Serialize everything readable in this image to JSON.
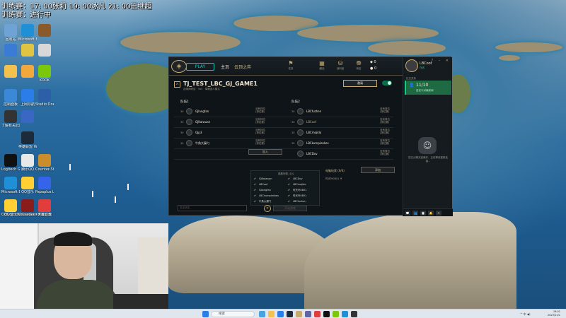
{
  "overlay": {
    "line1": "训练赛：17: 00张莉 19: 00冰凡 21: 00王继超",
    "line2": "训练赛：进行中"
  },
  "desktop_icons": [
    {
      "label": "回收站",
      "icon": "recycle-bin-icon",
      "color": "#6fa3d6"
    },
    {
      "label": "Microsoft Edge",
      "icon": "edge-icon",
      "color": "#1f8fd6"
    },
    {
      "label": "",
      "icon": "app-icon",
      "color": "#8b5a2b"
    },
    {
      "label": "",
      "icon": "app-icon",
      "color": "#3a7bd5"
    },
    {
      "label": "",
      "icon": "app-icon",
      "color": "#e1c542"
    },
    {
      "label": "",
      "icon": "app-icon",
      "color": "#d8d8d8"
    },
    {
      "label": "",
      "icon": "folder-icon",
      "color": "#f2c14e"
    },
    {
      "label": "",
      "icon": "app-icon",
      "color": "#f2a93b"
    },
    {
      "label": "KOOK",
      "icon": "kook-icon",
      "color": "#7ac70c"
    },
    {
      "label": "控制面板",
      "icon": "control-panel-icon",
      "color": "#3b88d8"
    },
    {
      "label": "上网导航",
      "icon": "browser-icon",
      "color": "#2b7de9"
    },
    {
      "label": "Studio One",
      "icon": "studio-one-icon",
      "color": "#2d5fa8"
    },
    {
      "label": "了解有关此图片的信息",
      "icon": "info-icon",
      "color": "#333"
    },
    {
      "label": "",
      "icon": "app-icon",
      "color": "#3a66c4"
    },
    {
      "label": "英雄联盟 WeGame",
      "icon": "lol-icon",
      "color": "#1d2a3a"
    },
    {
      "label": "Logitech G HUB",
      "icon": "logitech-icon",
      "color": "#111"
    },
    {
      "label": "腾讯QQ",
      "icon": "qq-icon",
      "color": "#e8e8e8"
    },
    {
      "label": "Counter-Strike 2",
      "icon": "cs2-icon",
      "color": "#c98d2c"
    },
    {
      "label": "Microsoft Edge",
      "icon": "edge-icon",
      "color": "#1f8fd6"
    },
    {
      "label": "QQ音乐",
      "icon": "qq-music-icon",
      "color": "#ffcf33"
    },
    {
      "label": "Papaplus Launcher",
      "icon": "launcher-icon",
      "color": "#3563e9"
    },
    {
      "label": "OBS Studio",
      "icon": "obs-icon",
      "color": "#222"
    },
    {
      "label": "Voicemeeter",
      "icon": "voicemeeter-icon",
      "color": "#335"
    },
    {
      "label": "英雄联盟",
      "icon": "lol-icon",
      "color": "#c8aa6e"
    },
    {
      "label": "QQ音乐",
      "icon": "qq-music-icon",
      "color": "#ffcf33"
    },
    {
      "label": "Crusader Kings III",
      "icon": "ck3-icon",
      "color": "#8a1c1c"
    },
    {
      "label": "天翼云盘",
      "icon": "cloud-icon",
      "color": "#e23d3d"
    }
  ],
  "client": {
    "nav": {
      "play": "PLAY",
      "home": "主页",
      "tft": "云顶之弈",
      "icons": [
        {
          "label": "任务",
          "icon": "missions-icon"
        },
        {
          "label": "藏品",
          "icon": "collection-icon"
        },
        {
          "label": "战利品",
          "icon": "loot-icon"
        },
        {
          "label": "商店",
          "icon": "store-icon"
        }
      ],
      "be": "0",
      "rp": "0"
    },
    "profile": {
      "name": "LBCoof",
      "status": "在线",
      "window_controls": "? – ✕"
    },
    "social": {
      "title": "社交关系",
      "party_count": "11/10",
      "party_sub": "自定义对局房间",
      "empty_text": "您已从聊天室离开，正在等待重新连接...",
      "bar_items": [
        "💬",
        "👥",
        "📋",
        "🔔",
        "⚙"
      ]
    },
    "lobby": {
      "title": "TJ_TEST_LBC_GJ_GAME1",
      "sub1": "召唤师峡谷 · 5v5 · 草稿选人模式",
      "sub2": "",
      "invite_label": "邀请"
    },
    "team1": {
      "label": "队伍1",
      "slots": [
        {
          "level": "30",
          "name": "GJlongfan",
          "rank": "没有排位",
          "rank2": "(排位赛)"
        },
        {
          "level": "30",
          "name": "GJKaiwuan",
          "rank": "没有排位",
          "rank2": "(排位赛)"
        },
        {
          "level": "30",
          "name": "GJp3",
          "rank": "没有排位",
          "rank2": "(排位赛)"
        },
        {
          "level": "30",
          "name": "牛角大漏勺",
          "rank": "没有排位",
          "rank2": "(排位赛)"
        }
      ],
      "join_label": "加入"
    },
    "team2": {
      "label": "队伍2",
      "slots": [
        {
          "level": "30",
          "name": "LBCfuzhen",
          "rank": "没有排位",
          "rank2": "(排位赛)"
        },
        {
          "level": "30",
          "name": "LBCoof",
          "rank": "没有排位",
          "rank2": "(排位赛)"
        },
        {
          "level": "30",
          "name": "LBCmojido",
          "rank": "没有排位",
          "rank2": "(排位赛)"
        },
        {
          "level": "30",
          "name": "LBCkumpienkes",
          "rank": "没有排位",
          "rank2": "(排位赛)"
        },
        {
          "level": "",
          "name": "LBCDov",
          "rank": "没有排位",
          "rank2": "(排位赛)"
        }
      ]
    },
    "spectators": {
      "title": "观看列表 (10)",
      "left": [
        "GJKaiwuan",
        "LBCoof",
        "GJlongfan",
        "LBChumpienkes",
        "牛角大漏勺"
      ],
      "right": [
        "LBCDov",
        "LBCmojido",
        "时光叶0801",
        "时光叶0801",
        "LBCfuzhen"
      ]
    },
    "bots": {
      "title": "电脑玩家 (0/4)",
      "add_label": "添加",
      "item": "时光叶0801"
    },
    "chat_placeholder": "发送消息...",
    "start_label": "开始游戏"
  },
  "taskbar": {
    "search": "搜索",
    "tray": "^ 中 ◀)",
    "time": "18:01",
    "date": "2023/12/1"
  }
}
